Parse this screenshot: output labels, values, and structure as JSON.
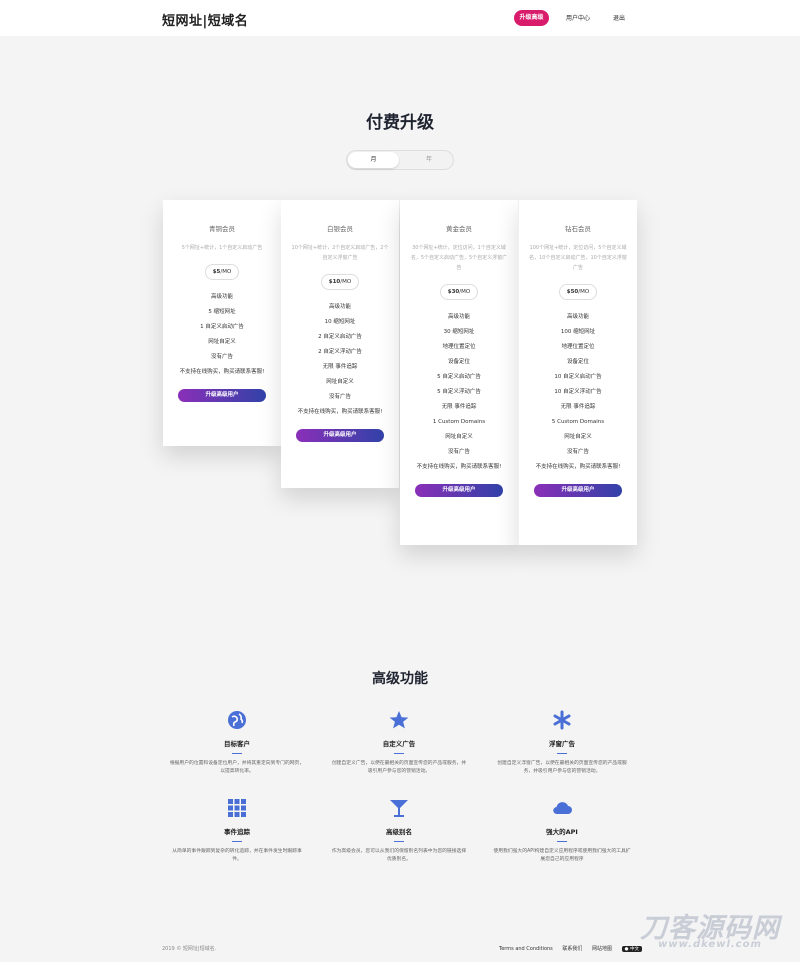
{
  "header": {
    "brand": "短网址|短域名",
    "nav": {
      "upgrade": "升级高级",
      "user_center": "用户中心",
      "logout": "退出"
    }
  },
  "pricing": {
    "title": "付费升级",
    "toggle": {
      "month": "月",
      "year": "年"
    },
    "plans": [
      {
        "name": "青铜会员",
        "desc": "5个网址+统计，1个自定义启动广告",
        "price": "$5",
        "period": "/MO",
        "features": [
          "高级功能",
          "5 缩短网址",
          "1 自定义启动广告",
          "网址自定义",
          "没有广告",
          "不支持在线购买，购买请联系客服!"
        ],
        "button": "升级高级用户"
      },
      {
        "name": "白银会员",
        "desc": "10个网址+统计，2个自定义启动广告，2个自定义浮窗广告",
        "price": "$10",
        "period": "/MO",
        "features": [
          "高级功能",
          "10 缩短网址",
          "2 自定义启动广告",
          "2 自定义浮动广告",
          "无限 事件追踪",
          "网址自定义",
          "没有广告",
          "不支持在线购买，购买请联系客服!"
        ],
        "button": "升级高级用户"
      },
      {
        "name": "黄金会员",
        "desc": "30个网址+统计，定位访问，1个自定义域名，5个自定义启动广告，5个自定义浮窗广告",
        "price": "$30",
        "period": "/MO",
        "features": [
          "高级功能",
          "30 缩短网址",
          "地理位置定位",
          "设备定位",
          "5 自定义启动广告",
          "5 自定义浮动广告",
          "无限 事件追踪",
          "1 Custom Domains",
          "网址自定义",
          "没有广告",
          "不支持在线购买，购买请联系客服!"
        ],
        "button": "升级高级用户"
      },
      {
        "name": "钻石会员",
        "desc": "100个网址+统计，定位访问，5个自定义域名，10个自定义启动广告，10个自定义浮窗广告",
        "price": "$50",
        "period": "/MO",
        "features": [
          "高级功能",
          "100 缩短网址",
          "地理位置定位",
          "设备定位",
          "10 自定义启动广告",
          "10 自定义浮动广告",
          "无限 事件追踪",
          "5 Custom Domains",
          "网址自定义",
          "没有广告",
          "不支持在线购买，购买请联系客服!"
        ],
        "button": "升级高级用户"
      }
    ]
  },
  "features_section": {
    "title": "高级功能",
    "items": [
      {
        "icon": "globe-icon",
        "title": "目标客户",
        "desc": "根据用户的位置和设备定位用户，并将其重定向到专门的网页，以提高转化率。"
      },
      {
        "icon": "star-icon",
        "title": "自定义广告",
        "desc": "创建自定义广告，以便在最相关的页面宣传您的产品或服务，并吸引用户参与您的营销活动。"
      },
      {
        "icon": "asterisk-icon",
        "title": "浮窗广告",
        "desc": "创建自定义浮窗广告，以便在最相关的页面宣传您的产品或服务，并吸引用户参与您的营销活动。"
      },
      {
        "icon": "grid-icon",
        "title": "事件追踪",
        "desc": "从简单的事件跟踪到复杂的转化追踪，并在事件发生时跟踪事件。"
      },
      {
        "icon": "cocktail-icon",
        "title": "高级别名",
        "desc": "作为高级会员，您可以从我们的保留别名列表中为您的链接选择优质别名。"
      },
      {
        "icon": "cloud-icon",
        "title": "强大的API",
        "desc": "使用我们强大的API构建自定义应用程序或使用我们强大的工具扩展您自己的应用程序"
      }
    ]
  },
  "footer": {
    "copyright": "2019 © 短网址|短域名.",
    "links": [
      "Terms and Conditions",
      "联系我们",
      "网站地图"
    ],
    "lang": "● 中文"
  },
  "watermark": {
    "big": "刀客源码网",
    "small": "www.dkewl.com"
  },
  "colors": {
    "accent_pink": "#d81b6a",
    "button_gradient_start": "#8a2fb8",
    "button_gradient_end": "#3242a8",
    "icon_blue": "#4a6fd6"
  }
}
